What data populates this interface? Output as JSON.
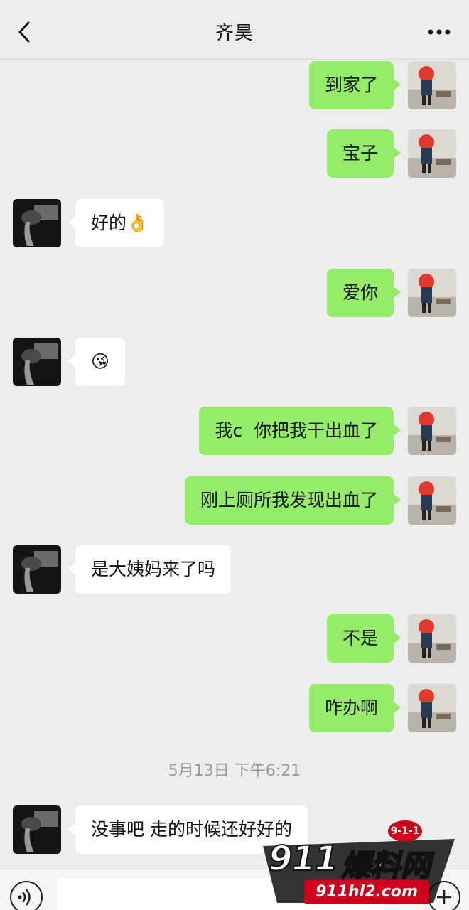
{
  "header": {
    "title": "齐昊",
    "back_icon": "chevron-left-icon",
    "more_icon": "more-dots-icon"
  },
  "messages": [
    {
      "sender": "me",
      "text": "到家了"
    },
    {
      "sender": "me",
      "text": "宝子"
    },
    {
      "sender": "them",
      "text": "好的👌"
    },
    {
      "sender": "me",
      "text": "爱你"
    },
    {
      "sender": "them",
      "text": "😘"
    },
    {
      "sender": "me",
      "text": "我c  你把我干出血了"
    },
    {
      "sender": "me",
      "text": "刚上厕所我发现出血了"
    },
    {
      "sender": "them",
      "text": "是大姨妈来了吗"
    },
    {
      "sender": "me",
      "text": "不是"
    },
    {
      "sender": "me",
      "text": "咋办啊"
    },
    {
      "sender": "them",
      "text": "没事吧 走的时候还好好的"
    }
  ],
  "timestamp": "5月13日 下午6:21",
  "bottom_bar": {
    "voice_icon": "voice-icon",
    "plus_icon": "plus-icon"
  },
  "watermark": {
    "brand": "911",
    "brand_cn": "爆料网",
    "url": "911hl2.com",
    "badge": "9-1-1"
  },
  "colors": {
    "background": "#ededed",
    "my_bubble": "#95ec69",
    "their_bubble": "#ffffff"
  }
}
